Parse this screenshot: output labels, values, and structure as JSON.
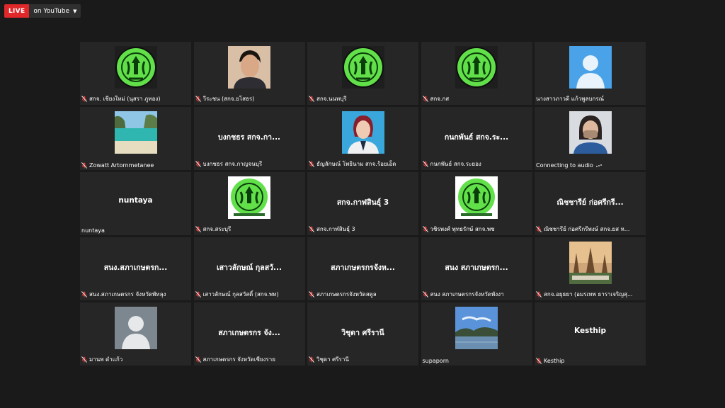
{
  "live": {
    "badge": "LIVE",
    "destination": "on YouTube"
  },
  "colors": {
    "live_red": "#e0282b",
    "mic_muted": "#e23b3b",
    "tile_bg": "#262626",
    "page_bg": "#1a1a1a"
  },
  "participants": [
    {
      "label": "สกจ. เชียงใหม่ (นุสรา ภูทอง)",
      "muted": true,
      "avatar": "seal"
    },
    {
      "label": "วีระชน (สกจ.ยโสธร)",
      "muted": true,
      "avatar": "person-photo"
    },
    {
      "label": "สกจ.นนทบุรี",
      "muted": true,
      "avatar": "seal"
    },
    {
      "label": "สกจ.กส",
      "muted": true,
      "avatar": "seal"
    },
    {
      "label": "นางสาวภาวดี แก้วพูลบกรณ์",
      "muted": false,
      "avatar": "default-blue"
    },
    {
      "label": "Zowatt Artornmetanee",
      "muted": true,
      "avatar": "beach-photo"
    },
    {
      "label": "บงกชธร สกจ.กาญจนบุรี",
      "muted": true,
      "center_name": "บงกชธร สกจ.กา..."
    },
    {
      "label": "ธัญลักษณ์ โพธินาม สกจ.ร้อยเอ็ด",
      "muted": true,
      "avatar": "woman-photo"
    },
    {
      "label": "กนกพันธ์ สกจ.ระยอง",
      "muted": true,
      "center_name": "กนกพันธ์ สกจ.ระ..."
    },
    {
      "label": "Connecting to audio",
      "muted": false,
      "connecting": true,
      "avatar": "mask-photo"
    },
    {
      "label": "nuntaya",
      "muted": false,
      "center_name": "nuntaya"
    },
    {
      "label": "สกจ.สระบุรี",
      "muted": true,
      "avatar": "seal-framed"
    },
    {
      "label": "สกจ.กาฬสินธุ์ 3",
      "muted": true,
      "center_name": "สกจ.กาฬสินธุ์ 3"
    },
    {
      "label": "วชิรพงศ์ พุทธรักษ์ สกจ.พช",
      "muted": true,
      "avatar": "seal-framed"
    },
    {
      "label": "ณิชชารีย์ ก่อศรีกรีพงษ์ สกจ.ยส ห...",
      "muted": true,
      "center_name": "ณิชชารีย์ ก่อศรีกรี..."
    },
    {
      "label": "สนง.สภาเกษตรกร จังหวัดพัทลุง",
      "muted": true,
      "center_name": "สนง.สภาเกษตรก..."
    },
    {
      "label": "เสาวลักษณ์ กุลสวัสดิ์ (สกจ.พท)",
      "muted": true,
      "center_name": "เสาวลักษณ์ กุลสวั..."
    },
    {
      "label": "สภาเกษตรกรจังหวัดสตูล",
      "muted": true,
      "center_name": "สภาเกษตรกรจังห..."
    },
    {
      "label": "สนง สภาเกษตรกรจังหวัดพังงา",
      "muted": true,
      "center_name": "สนง สภาเกษตรก..."
    },
    {
      "label": "สกจ.อยุธยา (อมรเทพ ธาราเจริญสุ...",
      "muted": true,
      "avatar": "temple-photo"
    },
    {
      "label": "มานพ ดำแก้ว",
      "muted": true,
      "avatar": "default-gray"
    },
    {
      "label": "สภาเกษตรกร จังหวัดเชียงราย",
      "muted": true,
      "center_name": "สภาเกษตรกร จัง..."
    },
    {
      "label": "วิชุดา ศรีรานี",
      "muted": true,
      "center_name": "วิชุดา ศรีรานี"
    },
    {
      "label": "supaporn",
      "muted": false,
      "avatar": "landscape-photo"
    },
    {
      "label": "Kesthip",
      "muted": true,
      "center_name": "Kesthip"
    }
  ]
}
